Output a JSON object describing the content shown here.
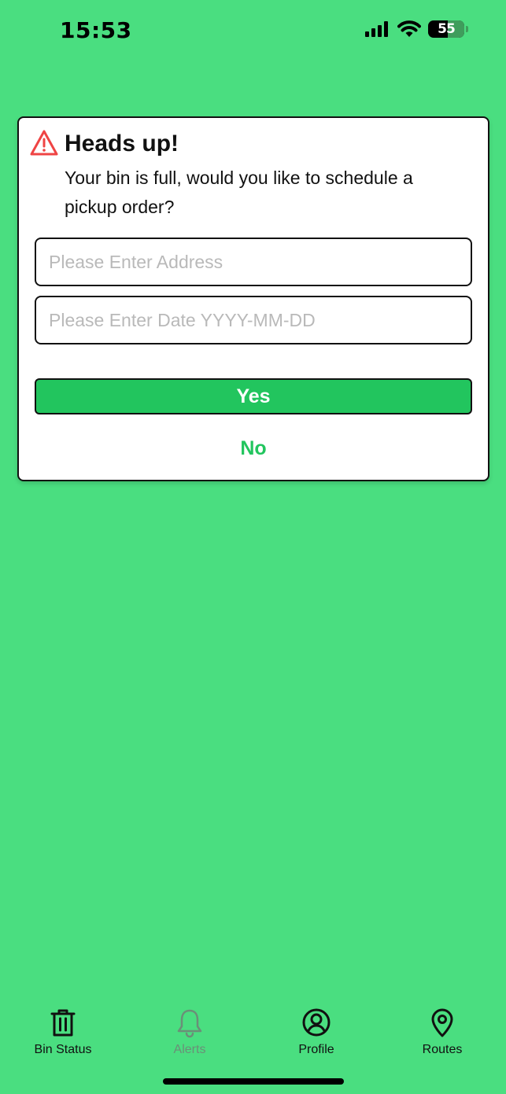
{
  "status_bar": {
    "time": "15:53",
    "battery_level": "55",
    "icons": [
      "cellular-signal-icon",
      "wifi-icon",
      "battery-icon"
    ]
  },
  "alert": {
    "icon": "warning-triangle-icon",
    "title": "Heads up!",
    "message": "Your bin is full, would you like to schedule a pickup order?",
    "address_input": {
      "value": "",
      "placeholder": "Please Enter Address"
    },
    "date_input": {
      "value": "",
      "placeholder": "Please Enter Date YYYY-MM-DD"
    },
    "yes_label": "Yes",
    "no_label": "No"
  },
  "tab_bar": {
    "items": [
      {
        "label": "Bin Status",
        "icon": "trash-bin-icon",
        "active": true
      },
      {
        "label": "Alerts",
        "icon": "bell-icon",
        "active": false
      },
      {
        "label": "Profile",
        "icon": "user-circle-icon",
        "active": true
      },
      {
        "label": "Routes",
        "icon": "map-pin-icon",
        "active": true
      }
    ]
  },
  "colors": {
    "background": "#4ade80",
    "accent": "#22c55e",
    "warning": "#ef4444",
    "inactive_tab": "#6b8f78"
  }
}
